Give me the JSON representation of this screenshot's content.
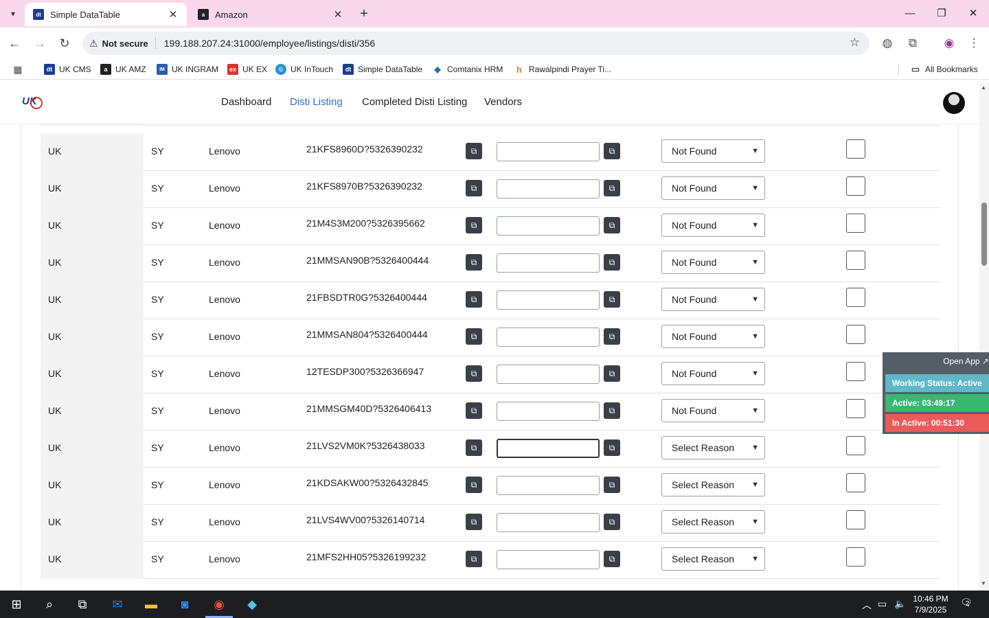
{
  "browser": {
    "tabs": [
      {
        "title": "Simple DataTable",
        "favicon": "dt"
      },
      {
        "title": "Amazon",
        "favicon": "a"
      }
    ],
    "address": {
      "security": "Not secure",
      "url": "199.188.207.24:31000/employee/listings/disti/356"
    },
    "bookmarks": [
      {
        "label": "UK CMS",
        "icon": "dt",
        "color": "#1b3d8f"
      },
      {
        "label": "UK AMZ",
        "icon": "a",
        "color": "#222222"
      },
      {
        "label": "UK INGRAM",
        "icon": "IM",
        "color": "#2a5db0"
      },
      {
        "label": "UK EX",
        "icon": "ex",
        "color": "#d9352b"
      },
      {
        "label": "UK InTouch",
        "icon": "©",
        "color": "#2a8fd6"
      },
      {
        "label": "Simple DataTable",
        "icon": "dt",
        "color": "#1b3d8f"
      },
      {
        "label": "Comtanix HRM",
        "icon": "◆",
        "color": "#1f6fb8"
      },
      {
        "label": "Rawalpindi Prayer Ti...",
        "icon": "h",
        "color": "#e0842d"
      }
    ],
    "all_bookmarks": "All Bookmarks"
  },
  "site": {
    "logo": "UK",
    "nav": [
      "Dashboard",
      "Disti Listing",
      "Completed Disti Listing",
      "Vendors"
    ],
    "active_nav": "Disti Listing"
  },
  "rows": [
    {
      "country": "UK",
      "code": "SY",
      "brand": "Lenovo",
      "sku": "21KFS8960D?5326390232",
      "reason": "Not Found"
    },
    {
      "country": "UK",
      "code": "SY",
      "brand": "Lenovo",
      "sku": "21KFS8970B?5326390232",
      "reason": "Not Found"
    },
    {
      "country": "UK",
      "code": "SY",
      "brand": "Lenovo",
      "sku": "21M4S3M200?5326395662",
      "reason": "Not Found"
    },
    {
      "country": "UK",
      "code": "SY",
      "brand": "Lenovo",
      "sku": "21MMSAN90B?5326400444",
      "reason": "Not Found"
    },
    {
      "country": "UK",
      "code": "SY",
      "brand": "Lenovo",
      "sku": "21FBSDTR0G?5326400444",
      "reason": "Not Found"
    },
    {
      "country": "UK",
      "code": "SY",
      "brand": "Lenovo",
      "sku": "21MMSAN804?5326400444",
      "reason": "Not Found"
    },
    {
      "country": "UK",
      "code": "SY",
      "brand": "Lenovo",
      "sku": "12TESDP300?5326366947",
      "reason": "Not Found"
    },
    {
      "country": "UK",
      "code": "SY",
      "brand": "Lenovo",
      "sku": "21MMSGM40D?5326406413",
      "reason": "Not Found"
    },
    {
      "country": "UK",
      "code": "SY",
      "brand": "Lenovo",
      "sku": "21LVS2VM0K?5326438033",
      "reason": "Select Reason"
    },
    {
      "country": "UK",
      "code": "SY",
      "brand": "Lenovo",
      "sku": "21KDSAKW00?5326432845",
      "reason": "Select Reason"
    },
    {
      "country": "UK",
      "code": "SY",
      "brand": "Lenovo",
      "sku": "21LVS4WV00?5326140714",
      "reason": "Select Reason"
    },
    {
      "country": "UK",
      "code": "SY",
      "brand": "Lenovo",
      "sku": "21MFS2HH05?5326199232",
      "reason": "Select Reason"
    }
  ],
  "widget": {
    "open_app": "Open App ↗",
    "status": "Working Status: Active",
    "active": "Active: 03:49:17",
    "inactive": "In Active: 00:51:30"
  },
  "taskbar": {
    "time": "10:46 PM",
    "date": "7/9/2025",
    "notifications": "2"
  }
}
